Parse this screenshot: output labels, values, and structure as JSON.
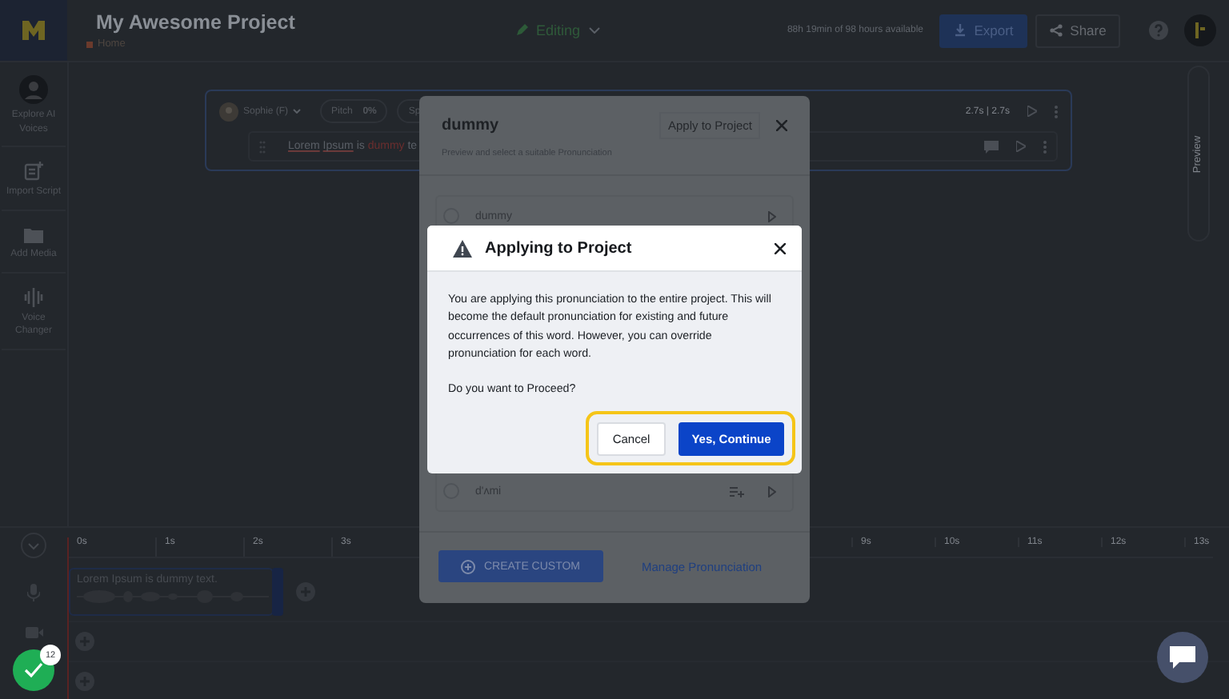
{
  "header": {
    "title": "My Awesome Project",
    "breadcrumb": "Home",
    "mode": "Editing",
    "usage": "88h 19min of 98 hours available",
    "export": "Export",
    "share": "Share"
  },
  "sidebar": {
    "items": [
      {
        "label": "Explore AI Voices",
        "kind": "avatar"
      },
      {
        "label": "Import Script",
        "kind": "script"
      },
      {
        "label": "Add Media",
        "kind": "media"
      },
      {
        "label": "Voice Changer",
        "kind": "changer"
      }
    ]
  },
  "editor_block": {
    "voice": "Sophie (F)",
    "pitch_label": "Pitch",
    "pitch_value": "0%",
    "speed_label": "Sp",
    "duration": "2.7s | 2.7s",
    "text_parts": [
      {
        "text": "Lorem",
        "kind": "underlined"
      },
      {
        "text": "Ipsum",
        "kind": "underlined"
      },
      {
        "text": "is",
        "kind": "plain"
      },
      {
        "text": "dummy",
        "kind": "highlight"
      },
      {
        "text": "te",
        "kind": "plain"
      }
    ]
  },
  "preview_tab": "Preview",
  "timeline": {
    "ticks_left": [
      "0s",
      "1s",
      "2s",
      "3s"
    ],
    "ticks_right": [
      "9s",
      "10s",
      "11s",
      "12s",
      "13s"
    ],
    "clip_text": "Lorem Ipsum is dummy text."
  },
  "status_badge": {
    "count": "12"
  },
  "pronunciation_modal": {
    "word": "dummy",
    "apply_button": "Apply to Project",
    "subtitle": "Preview and select a suitable Pronunciation",
    "options": [
      {
        "label": "dummy",
        "kind": "original",
        "selected": false
      },
      {
        "label": "d'ʌmi",
        "kind": "phonetic",
        "selected": false
      }
    ],
    "create_button": "CREATE CUSTOM",
    "manage_link": "Manage Pronunciation"
  },
  "confirm_dialog": {
    "title": "Applying to Project",
    "message": "You are applying this pronunciation to the entire project. This will become the default pronunciation for existing and future occurrences of this word. However, you can override pronunciation for each word.",
    "question": "Do you want to Proceed?",
    "cancel": "Cancel",
    "confirm": "Yes, Continue"
  }
}
